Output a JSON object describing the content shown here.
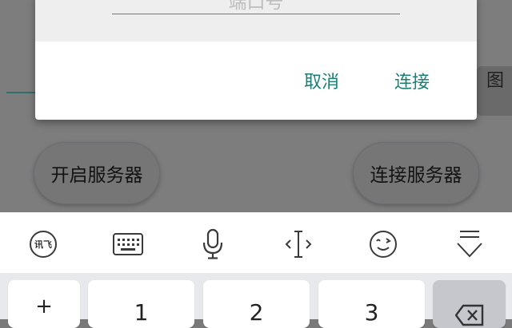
{
  "app": {
    "image_button_label": "图",
    "start_server_label": "开启服务器",
    "connect_server_label": "连接服务器"
  },
  "dialog": {
    "port_placeholder": "端口号",
    "cancel_label": "取消",
    "connect_label": "连接"
  },
  "keyboard": {
    "toolbar_icons": [
      "ifly-logo-icon",
      "keyboard-icon",
      "microphone-icon",
      "cursor-move-icon",
      "emoji-icon",
      "collapse-keyboard-icon"
    ],
    "logo_text": "讯飞",
    "keys": {
      "symbol": "+",
      "one": "1",
      "two": "2",
      "three": "3"
    }
  },
  "colors": {
    "accent": "#1a7f74",
    "dim_overlay": "#7d7d7d"
  }
}
